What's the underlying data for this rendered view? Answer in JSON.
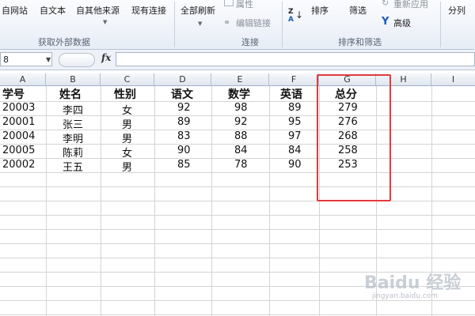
{
  "ribbon": {
    "get_data": {
      "from_web": "自网站",
      "from_text": "自文本",
      "from_other": "自其他来源",
      "existing_conn": "现有连接",
      "group_label": "获取外部数据"
    },
    "connections": {
      "refresh_all": "全部刷新",
      "properties": "属性",
      "edit_links": "编辑链接",
      "group_label": "连接"
    },
    "sort_filter": {
      "sort": "排序",
      "filter": "筛选",
      "reapply": "重新应用",
      "advanced": "高级",
      "group_label": "排序和筛选",
      "sort_icon_top": "Z",
      "sort_icon_bottom": "A"
    },
    "data_tools": {
      "split": "分列"
    }
  },
  "formula_bar": {
    "name_box": "8",
    "fx": "fx",
    "formula": ""
  },
  "columns": [
    "A",
    "B",
    "C",
    "D",
    "E",
    "F",
    "G",
    "H",
    "I"
  ],
  "table": {
    "headers": [
      "学号",
      "姓名",
      "性别",
      "语文",
      "数学",
      "英语",
      "总分"
    ],
    "rows": [
      [
        "20003",
        "李四",
        "女",
        "92",
        "98",
        "89",
        "279"
      ],
      [
        "20001",
        "张三",
        "男",
        "89",
        "92",
        "95",
        "276"
      ],
      [
        "20004",
        "李明",
        "男",
        "83",
        "88",
        "97",
        "268"
      ],
      [
        "20005",
        "陈莉",
        "女",
        "90",
        "84",
        "84",
        "258"
      ],
      [
        "20002",
        "王五",
        "男",
        "85",
        "78",
        "90",
        "253"
      ]
    ]
  },
  "colors": {
    "highlight": "#e23b3b"
  },
  "watermark": {
    "text": "Baidu 经验",
    "sub": "jingyan.baidu.com"
  }
}
